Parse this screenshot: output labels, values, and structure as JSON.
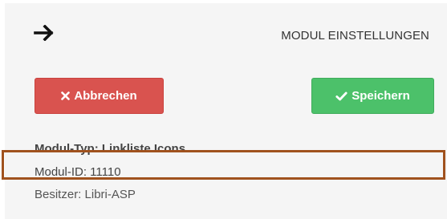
{
  "header": {
    "back_icon": "arrow-right-icon",
    "title": "MODUL EINSTELLUNGEN"
  },
  "actions": {
    "cancel_label": "Abbrechen",
    "cancel_icon": "times-icon",
    "cancel_color": "#d9534f",
    "save_label": "Speichern",
    "save_icon": "check-icon",
    "save_color": "#4cc16a"
  },
  "module_info": {
    "type": "Modul-Typ: Linkliste Icons",
    "id": "Modul-ID: 11110",
    "owner": "Besitzer: Libri-ASP"
  },
  "annotation": {
    "highlight_color": "#a0521e"
  }
}
